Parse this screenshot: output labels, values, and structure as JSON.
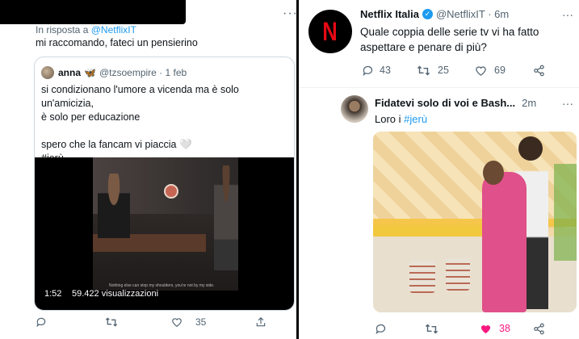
{
  "left_tweet": {
    "reply_label": "In risposta a",
    "reply_mention": "@NetflixIT",
    "text": "mi raccomando, fateci un pensierino",
    "more_icon": "ellipsis-icon",
    "quote": {
      "name": "anna",
      "emoji": "🦋",
      "handle": "@tzsoempire · 1 feb",
      "line1": "si condizionano l'umore a vicenda ma è solo un'amicizia,",
      "line2": "è solo per educazione",
      "line3": "spero che la fancam vi piaccia",
      "heart": "🤍",
      "hashtag": "#jerù",
      "video": {
        "duration": "1:52",
        "views": "59.422 visualizzazioni",
        "caption": "Nothing else can stop my shoulders, you're not by my side."
      }
    },
    "actions": {
      "reply_icon": "reply-icon",
      "retweet_icon": "retweet-icon",
      "like_icon": "heart-icon",
      "like_count": "35",
      "share_icon": "share-icon"
    }
  },
  "right_tweet": {
    "name": "Netflix Italia",
    "handle": "@NetflixIT · 6m",
    "text": "Quale coppia delle serie tv vi ha fatto aspettare e penare di più?",
    "more_icon": "ellipsis-icon",
    "brand_color": "#e50914",
    "actions": {
      "reply_count": "43",
      "retweet_count": "25",
      "like_count": "69"
    },
    "reply": {
      "name": "Fidatevi solo di voi e Bash...",
      "time": "2m",
      "text_prefix": "Loro i",
      "hashtag": "#jerù",
      "actions": {
        "like_count": "38",
        "like_color": "#f91880"
      }
    }
  }
}
